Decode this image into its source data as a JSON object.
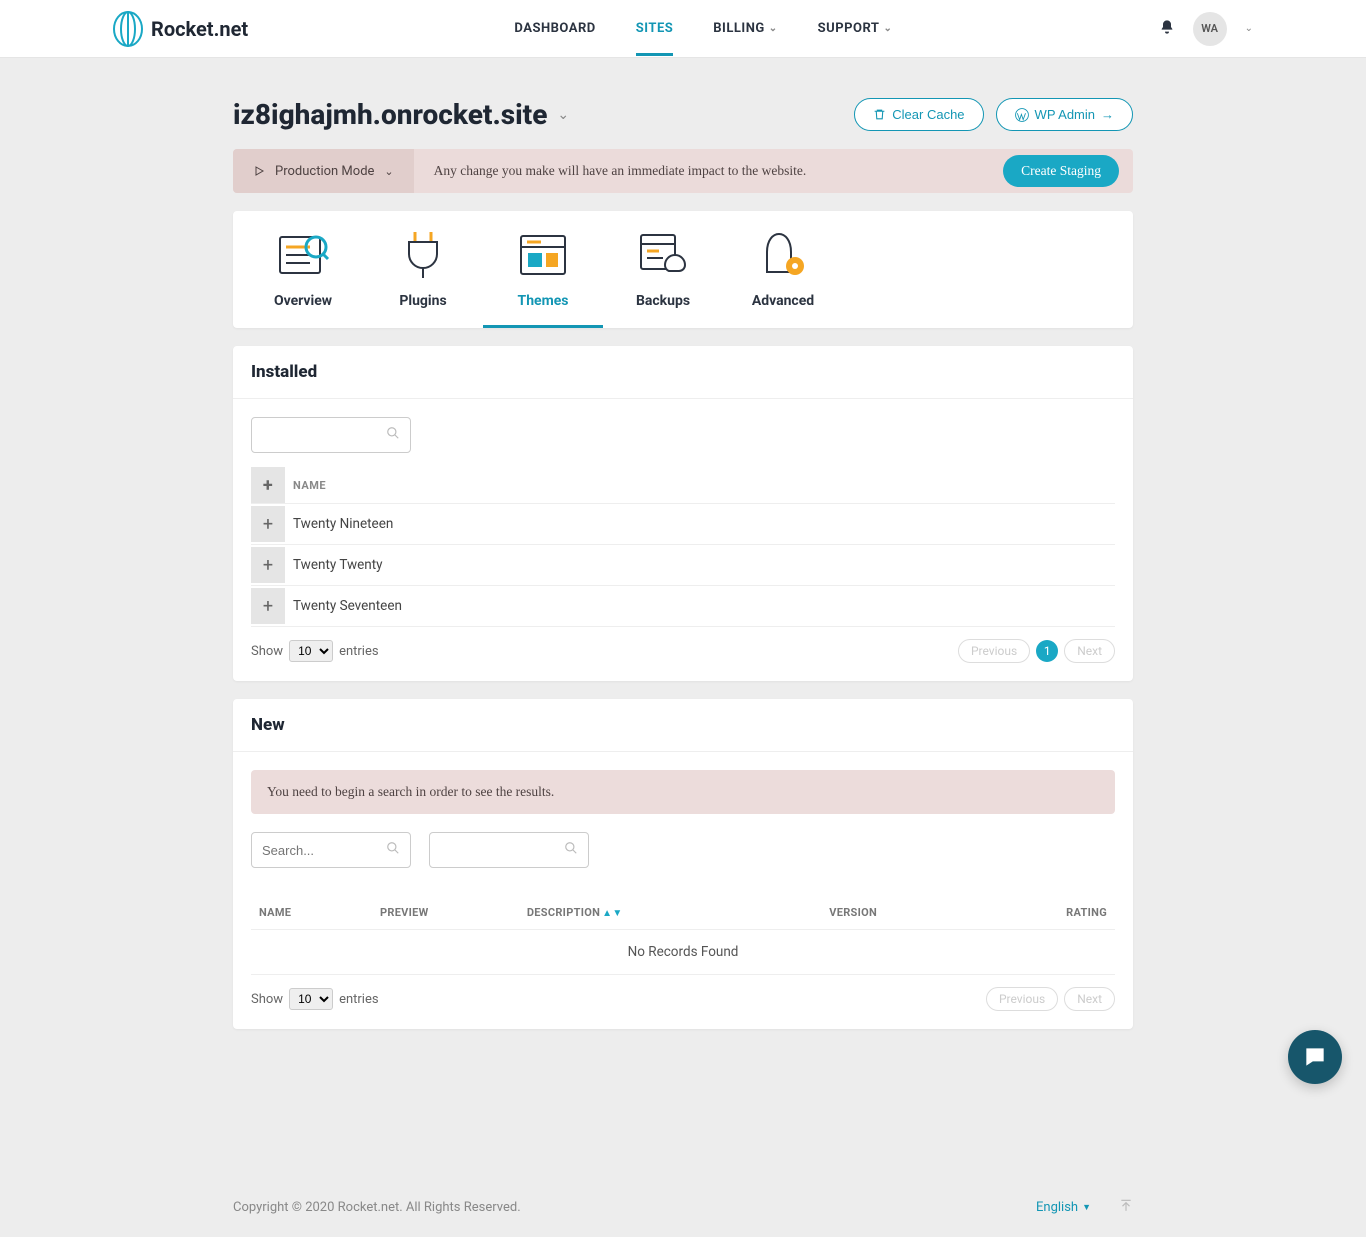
{
  "brand": {
    "name": "Rocket.net"
  },
  "nav": {
    "dashboard": "DASHBOARD",
    "sites": "SITES",
    "billing": "BILLING",
    "support": "SUPPORT"
  },
  "user": {
    "initials": "WA"
  },
  "site": {
    "domain": "iz8ighajmh.onrocket.site",
    "clear_cache": "Clear Cache",
    "wp_admin": "WP Admin"
  },
  "mode": {
    "label": "Production Mode",
    "message": "Any change you make will have an immediate impact to the website.",
    "create_staging": "Create Staging"
  },
  "tabs": {
    "overview": "Overview",
    "plugins": "Plugins",
    "themes": "Themes",
    "backups": "Backups",
    "advanced": "Advanced"
  },
  "installed": {
    "title": "Installed",
    "name_header": "NAME",
    "rows": [
      {
        "name": "Twenty Nineteen"
      },
      {
        "name": "Twenty Twenty"
      },
      {
        "name": "Twenty Seventeen"
      }
    ],
    "show": "Show",
    "entries": "entries",
    "select_val": "10",
    "prev": "Previous",
    "page": "1",
    "next": "Next"
  },
  "new": {
    "title": "New",
    "notice": "You need to begin a search in order to see the results.",
    "search_placeholder": "Search...",
    "cols": {
      "name": "NAME",
      "preview": "PREVIEW",
      "description": "DESCRIPTION",
      "version": "VERSION",
      "rating": "RATING"
    },
    "empty": "No Records Found",
    "show": "Show",
    "entries": "entries",
    "select_val": "10",
    "prev": "Previous",
    "next": "Next"
  },
  "footer": {
    "copyright": "Copyright © 2020 Rocket.net. All Rights Reserved.",
    "language": "English"
  }
}
